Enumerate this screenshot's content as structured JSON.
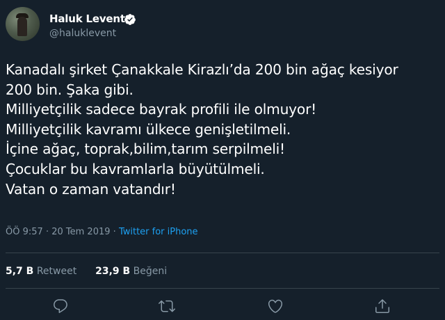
{
  "user": {
    "display_name": "Haluk Levent",
    "handle": "@haluklevent"
  },
  "tweet": {
    "lines": [
      "Kanadalı şirket Çanakkale Kirazlı’da 200 bin ağaç kesiyor",
      "200 bin. Şaka gibi.",
      "Milliyetçilik sadece bayrak profili ile olmuyor!",
      "Milliyetçilik kavramı ülkece genişletilmeli.",
      "İçine ağaç, toprak,bilim,tarım serpilmeli!",
      "Çocuklar bu kavramlarla  büyütülmeli.",
      "Vatan o zaman vatandır!"
    ],
    "time": "ÖÖ 9:57",
    "separator": "·",
    "date": "20 Tem 2019",
    "source": "Twitter for iPhone"
  },
  "stats": {
    "retweet_count": "5,7 B",
    "retweet_label": "Retweet",
    "like_count": "23,9 B",
    "like_label": "Beğeni"
  },
  "icons": {
    "verified": "verified-badge-icon",
    "reply": "reply-icon",
    "retweet": "retweet-icon",
    "like": "heart-icon",
    "share": "share-icon"
  },
  "colors": {
    "background": "#15202b",
    "text": "#ffffff",
    "secondary": "#8899a6",
    "accent": "#1da1f2",
    "divider": "#38444d"
  }
}
